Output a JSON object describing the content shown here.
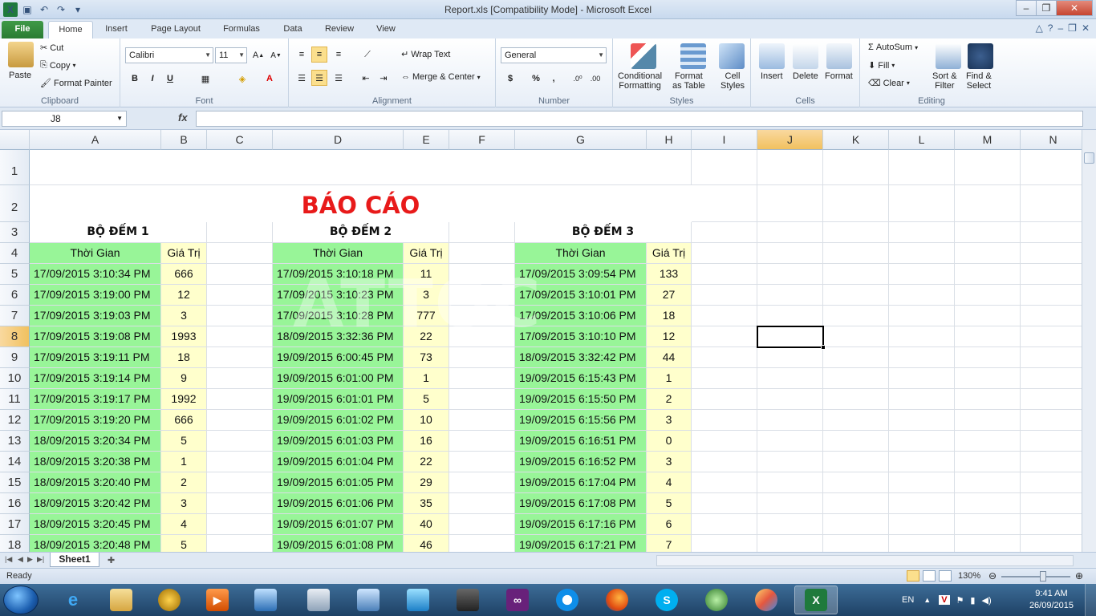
{
  "window": {
    "title": "Report.xls  [Compatibility Mode] - Microsoft Excel"
  },
  "ribbon_tabs": [
    "File",
    "Home",
    "Insert",
    "Page Layout",
    "Formulas",
    "Data",
    "Review",
    "View"
  ],
  "active_tab": "Home",
  "clipboard": {
    "paste": "Paste",
    "cut": "Cut",
    "copy": "Copy",
    "format_painter": "Format Painter",
    "label": "Clipboard"
  },
  "font": {
    "name": "Calibri",
    "size": "11",
    "bold": "B",
    "italic": "I",
    "underline": "U",
    "label": "Font"
  },
  "alignment": {
    "wrap_text": "Wrap Text",
    "merge_center": "Merge & Center",
    "label": "Alignment"
  },
  "number": {
    "format": "General",
    "currency": "$",
    "percent": "%",
    "comma": ",",
    "label": "Number"
  },
  "styles": {
    "conditional": "Conditional",
    "conditional2": "Formatting",
    "format_as": "Format",
    "format_as2": "as Table",
    "cell": "Cell",
    "cell2": "Styles",
    "label": "Styles"
  },
  "cells": {
    "insert": "Insert",
    "delete": "Delete",
    "format": "Format",
    "label": "Cells"
  },
  "editing": {
    "autosum": "AutoSum",
    "fill": "Fill",
    "clear": "Clear",
    "sort": "Sort &",
    "sort2": "Filter",
    "find": "Find &",
    "find2": "Select",
    "label": "Editing"
  },
  "formula_bar": {
    "name_box": "J8",
    "fx": "fx",
    "formula": ""
  },
  "columns": [
    "A",
    "B",
    "C",
    "D",
    "E",
    "F",
    "G",
    "H",
    "I",
    "J",
    "K",
    "L",
    "M",
    "N"
  ],
  "selected_column": "J",
  "selected_row": 8,
  "rows": [
    1,
    2,
    3,
    4,
    5,
    6,
    7,
    8,
    9,
    10,
    11,
    12,
    13,
    14,
    15,
    16,
    17,
    18
  ],
  "sheet": {
    "title": "BÁO CÁO",
    "watermark": "ATTOC",
    "counter_names": [
      "BỘ ĐẾM 1",
      "BỘ ĐẾM 2",
      "BỘ ĐẾM 3"
    ],
    "time_header": "Thời Gian",
    "value_header": "Giá Trị",
    "counter1": [
      [
        "17/09/2015 3:10:34 PM",
        "666"
      ],
      [
        "17/09/2015 3:19:00 PM",
        "12"
      ],
      [
        "17/09/2015 3:19:03 PM",
        "3"
      ],
      [
        "17/09/2015 3:19:08 PM",
        "1993"
      ],
      [
        "17/09/2015 3:19:11 PM",
        "18"
      ],
      [
        "17/09/2015 3:19:14 PM",
        "9"
      ],
      [
        "17/09/2015 3:19:17 PM",
        "1992"
      ],
      [
        "17/09/2015 3:19:20 PM",
        "666"
      ],
      [
        "18/09/2015 3:20:34 PM",
        "5"
      ],
      [
        "18/09/2015 3:20:38 PM",
        "1"
      ],
      [
        "18/09/2015 3:20:40 PM",
        "2"
      ],
      [
        "18/09/2015 3:20:42 PM",
        "3"
      ],
      [
        "18/09/2015 3:20:45 PM",
        "4"
      ],
      [
        "18/09/2015 3:20:48 PM",
        "5"
      ]
    ],
    "counter2": [
      [
        "17/09/2015 3:10:18 PM",
        "11"
      ],
      [
        "17/09/2015 3:10:23 PM",
        "3"
      ],
      [
        "17/09/2015 3:10:28 PM",
        "777"
      ],
      [
        "18/09/2015 3:32:36 PM",
        "22"
      ],
      [
        "19/09/2015 6:00:45 PM",
        "73"
      ],
      [
        "19/09/2015 6:01:00 PM",
        "1"
      ],
      [
        "19/09/2015 6:01:01 PM",
        "5"
      ],
      [
        "19/09/2015 6:01:02 PM",
        "10"
      ],
      [
        "19/09/2015 6:01:03 PM",
        "16"
      ],
      [
        "19/09/2015 6:01:04 PM",
        "22"
      ],
      [
        "19/09/2015 6:01:05 PM",
        "29"
      ],
      [
        "19/09/2015 6:01:06 PM",
        "35"
      ],
      [
        "19/09/2015 6:01:07 PM",
        "40"
      ],
      [
        "19/09/2015 6:01:08 PM",
        "46"
      ]
    ],
    "counter3": [
      [
        "17/09/2015 3:09:54 PM",
        "133"
      ],
      [
        "17/09/2015 3:10:01 PM",
        "27"
      ],
      [
        "17/09/2015 3:10:06 PM",
        "18"
      ],
      [
        "17/09/2015 3:10:10 PM",
        "12"
      ],
      [
        "18/09/2015 3:32:42 PM",
        "44"
      ],
      [
        "19/09/2015 6:15:43 PM",
        "1"
      ],
      [
        "19/09/2015 6:15:50 PM",
        "2"
      ],
      [
        "19/09/2015 6:15:56 PM",
        "3"
      ],
      [
        "19/09/2015 6:16:51 PM",
        "0"
      ],
      [
        "19/09/2015 6:16:52 PM",
        "3"
      ],
      [
        "19/09/2015 6:17:04 PM",
        "4"
      ],
      [
        "19/09/2015 6:17:08 PM",
        "5"
      ],
      [
        "19/09/2015 6:17:16 PM",
        "6"
      ],
      [
        "19/09/2015 6:17:21 PM",
        "7"
      ]
    ]
  },
  "sheet_tab": "Sheet1",
  "status": {
    "ready": "Ready",
    "zoom": "130%"
  },
  "taskbar": {
    "lang": "EN",
    "time": "9:41 AM",
    "date": "26/09/2015"
  },
  "colors": {
    "time_fill": "#98f598",
    "value_fill": "#ffffcc",
    "title_color": "#e81a1a",
    "selected_header": "#f1c15f"
  }
}
